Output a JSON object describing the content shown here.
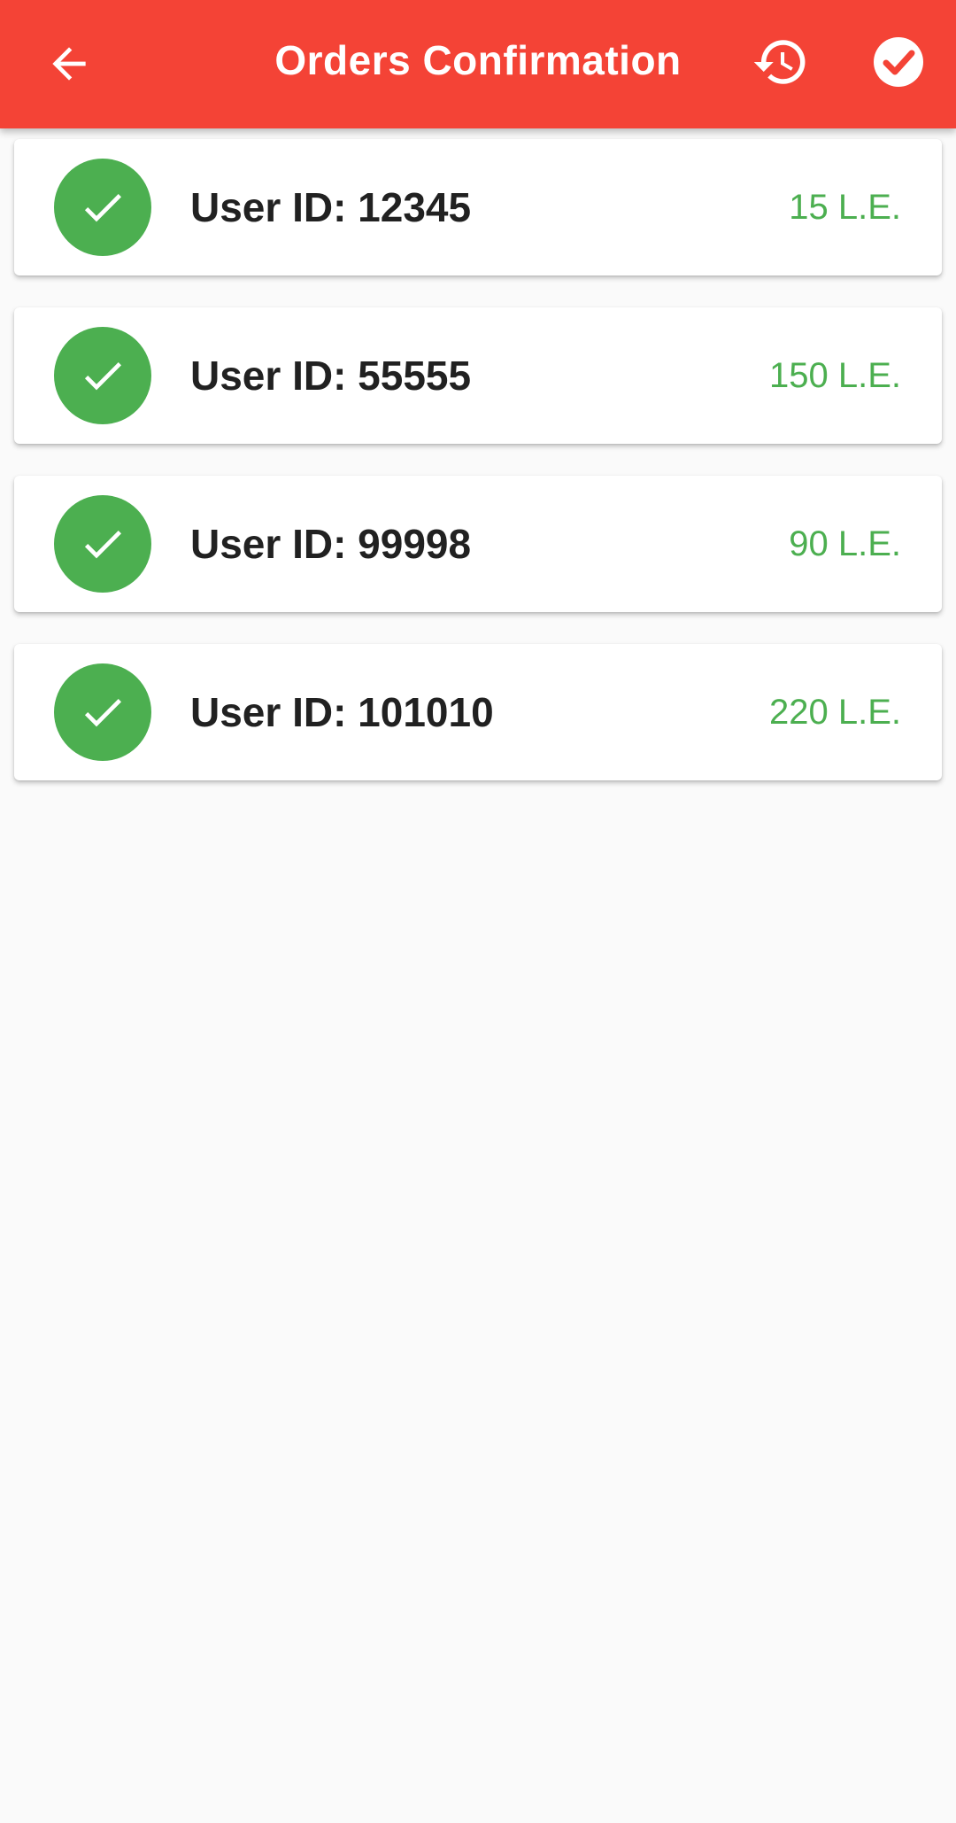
{
  "app_bar": {
    "title": "Orders Confirmation",
    "back_icon": "arrow-back-icon",
    "history_icon": "history-icon",
    "confirm_icon": "check-circle-icon",
    "background_color": "#f44336"
  },
  "orders": [
    {
      "user_id_label": "User ID: 12345",
      "amount": "15 L.E.",
      "status_icon": "check-icon"
    },
    {
      "user_id_label": "User ID: 55555",
      "amount": "150 L.E.",
      "status_icon": "check-icon"
    },
    {
      "user_id_label": "User ID: 99998",
      "amount": "90 L.E.",
      "status_icon": "check-icon"
    },
    {
      "user_id_label": "User ID: 101010",
      "amount": "220 L.E.",
      "status_icon": "check-icon"
    }
  ],
  "colors": {
    "accent_green": "#4caf50",
    "text_dark": "#212121",
    "page_background": "#fafafa"
  }
}
